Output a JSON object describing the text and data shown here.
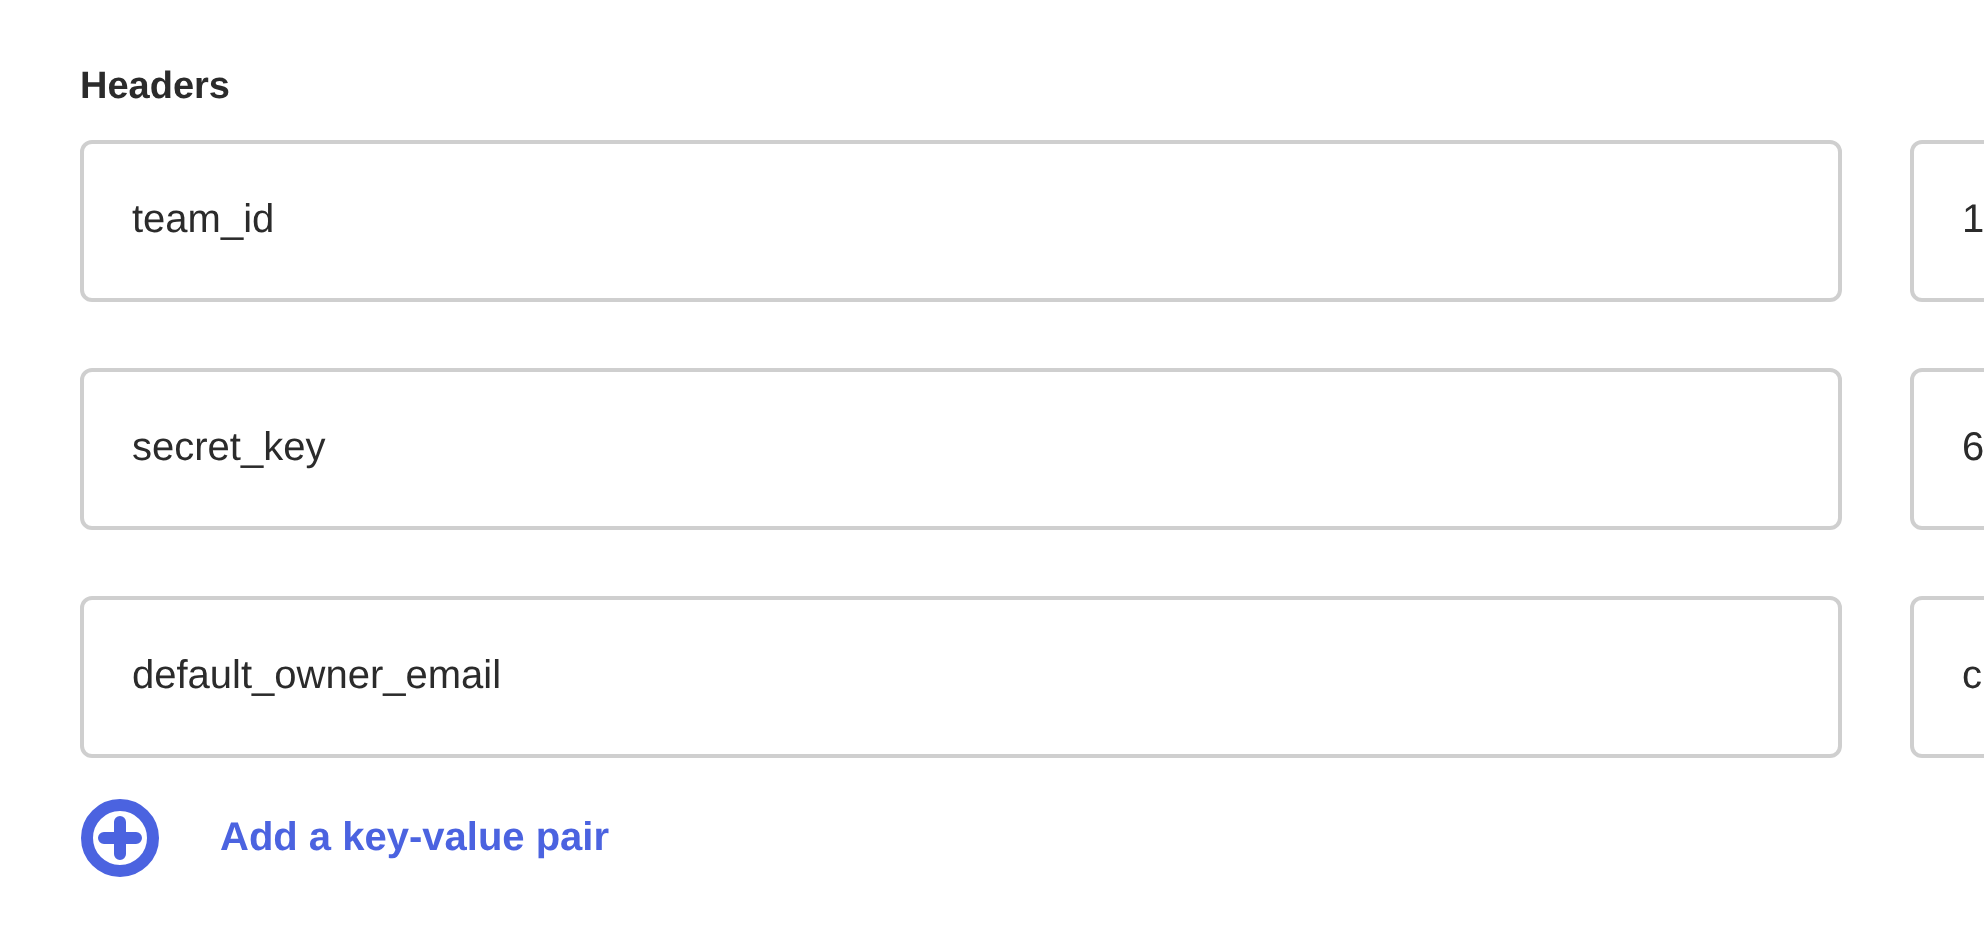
{
  "section_title": "Headers",
  "headers": [
    {
      "key": "team_id",
      "value": "1"
    },
    {
      "key": "secret_key",
      "value": "6"
    },
    {
      "key": "default_owner_email",
      "value": "c"
    }
  ],
  "add_link": "Add a key-value pair"
}
